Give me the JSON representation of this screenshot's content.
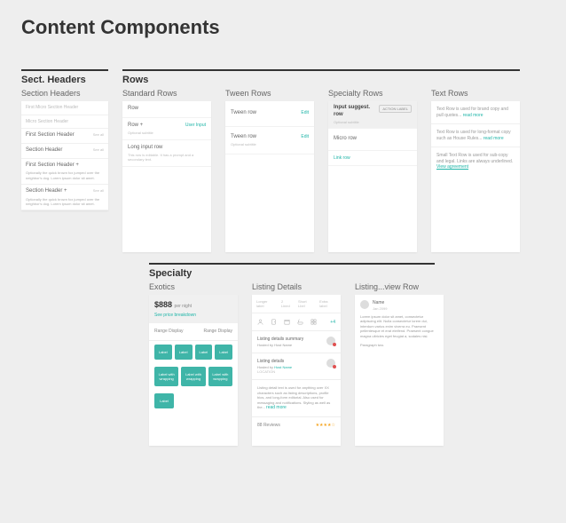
{
  "page_title": "Content Components",
  "sect_headers": {
    "title": "Sect. Headers",
    "sub": "Section Headers",
    "items": [
      {
        "title": "First Micro Section Header",
        "desc": ""
      },
      {
        "title": "Micro Section Header",
        "desc": ""
      },
      {
        "title": "First Section Header",
        "desc": "",
        "right": "See all"
      },
      {
        "title": "Section Header",
        "desc": "",
        "right": "See all"
      },
      {
        "title": "First Section Header +",
        "desc": "Optionally the quick brown fox jumped over the neighbor's dog. Lorem ipsum dolor sit amet."
      },
      {
        "title": "Section Header +",
        "desc": "Optionally the quick brown fox jumped over the neighbor's dog. Lorem ipsum dolor sit amet.",
        "right": "See all"
      }
    ]
  },
  "rows": {
    "title": "Rows",
    "standard": {
      "sub": "Standard Rows",
      "items": [
        {
          "label": "Row",
          "sub": ""
        },
        {
          "label": "Row +",
          "sub": "Optional subtitle",
          "action": "User Input"
        },
        {
          "label": "Long input row",
          "sub": "This row is editable. It has a prompt and a secondary text."
        }
      ]
    },
    "tween": {
      "sub": "Tween Rows",
      "items": [
        {
          "label": "Tween row",
          "action": "Edit"
        },
        {
          "label": "Tween row",
          "sub": "Optional subtitle",
          "action": "Edit"
        }
      ]
    },
    "specialty": {
      "sub": "Specialty Rows",
      "input": {
        "label": "Input suggest. row",
        "sub": "Optional subtitle",
        "btn": "ACTION LABEL"
      },
      "micro": "Micro row",
      "link": "Link row"
    },
    "text": {
      "sub": "Text Rows",
      "items": [
        {
          "copy": "Text Row is used for brand copy and pull quotes...",
          "more": "read more"
        },
        {
          "copy": "Text Row is used for long-format copy such as House Rules...",
          "more": "read more"
        },
        {
          "copy": "Small Text Row is used for sub-copy and legal. Links are always underlined.",
          "more": "View agreement"
        }
      ]
    }
  },
  "specialty": {
    "title": "Specialty",
    "exotics": {
      "sub": "Exotics",
      "price": "$888",
      "price_sub": "per night",
      "breakdown": "See price breakdown",
      "range_label": "Range Display",
      "chips_r1": [
        "Label",
        "Label",
        "Label",
        "Label"
      ],
      "chips_r2": [
        "Label with wrapping",
        "Label with wrapping",
        "Label with wrapping"
      ],
      "chips_r3": [
        "Label"
      ]
    },
    "listing": {
      "sub": "Listing Details",
      "tabs": [
        "Longer label",
        "2 Lined",
        "Short Lbel",
        "Extra label"
      ],
      "icons": [
        "user-icon",
        "door-icon",
        "calendar-icon",
        "bath-icon",
        "grid-icon"
      ],
      "plus": "+4",
      "summary": {
        "title": "Listing details summary",
        "host": "Hosted by Host Name"
      },
      "details": {
        "title": "Listing details",
        "host_prefix": "Hosted by",
        "host": "Host Name",
        "loc": "LOCATION"
      },
      "body": "Listing detail text is used for anything over XX characters such as listing descriptions, profile bios, and long-form editorial. Also used for messaging and notifications. Styling as well as the...",
      "body_more": "read more",
      "reviews_count": "88 Reviews",
      "stars": "★★★★☆"
    },
    "review": {
      "sub": "Listing...view Row",
      "name": "Name",
      "date": "Jan 2099",
      "body": "Lorem ipsum dolor sit amet, consectetur adipiscing elit. Nulla consectetur lorem dui, interdum varius enim viverra eu. Praesent pellentesque et erat eleifend. Praesent congue magna ultricies eget feugiat a, sodales nisi.",
      "body2": "Paragraph two."
    }
  }
}
